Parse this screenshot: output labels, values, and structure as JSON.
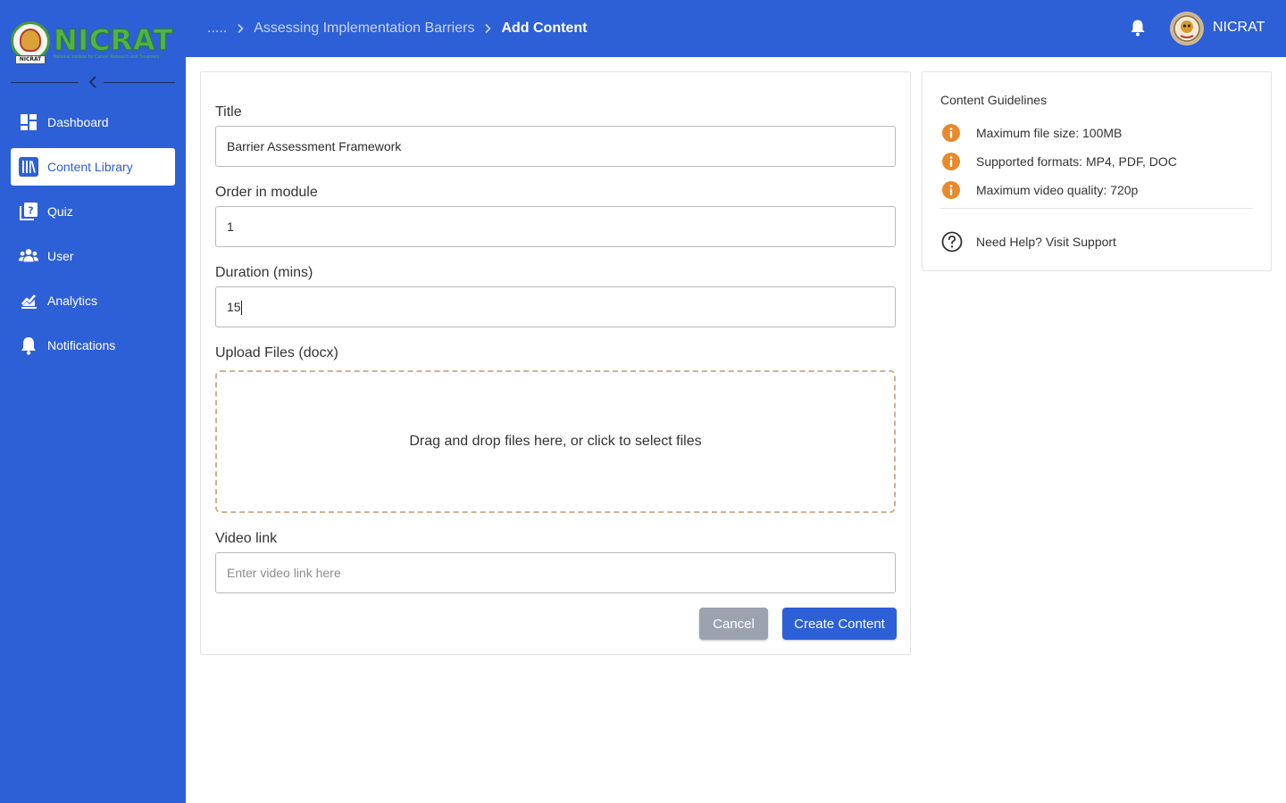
{
  "brand": {
    "name": "NICRAT",
    "emblem_banner": "NICRAT",
    "tagline": "National Institute for Cancer Research and Treatment"
  },
  "sidebar": {
    "items": [
      {
        "label": "Dashboard",
        "icon": "dashboard-icon",
        "active": false
      },
      {
        "label": "Content Library",
        "icon": "library-icon",
        "active": true
      },
      {
        "label": "Quiz",
        "icon": "quiz-icon",
        "active": false
      },
      {
        "label": "User",
        "icon": "users-icon",
        "active": false
      },
      {
        "label": "Analytics",
        "icon": "analytics-icon",
        "active": false
      },
      {
        "label": "Notifications",
        "icon": "bell-icon",
        "active": false
      }
    ]
  },
  "header": {
    "breadcrumb": {
      "ellipsis": ".....",
      "parent": "Assessing Implementation Barriers",
      "current": "Add Content"
    },
    "username": "NICRAT"
  },
  "form": {
    "title_label": "Title",
    "title_value": "Barrier Assessment Framework",
    "order_label": "Order in module",
    "order_value": "1",
    "duration_label": "Duration (mins)",
    "duration_value": "15",
    "upload_label": "Upload Files (docx)",
    "dropzone_text": "Drag and drop files here, or click to select files",
    "video_label": "Video link",
    "video_placeholder": "Enter video link here",
    "cancel_label": "Cancel",
    "create_label": "Create Content"
  },
  "guidelines": {
    "title": "Content Guidelines",
    "items": [
      "Maximum file size: 100MB",
      "Supported formats: MP4, PDF, DOC",
      "Maximum video quality: 720p"
    ],
    "help": "Need Help? Visit Support"
  },
  "colors": {
    "primary": "#2d5fd6",
    "logo_green": "#4fb345",
    "info_orange": "#e8892b",
    "dropzone_border": "#d1b08e",
    "cancel_gray": "#9aa3ae"
  }
}
